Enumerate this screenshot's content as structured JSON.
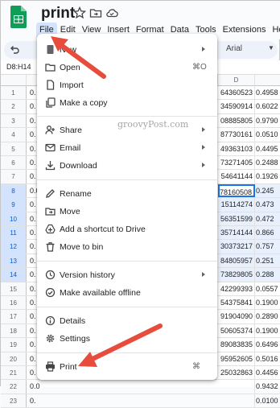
{
  "document": {
    "title": "print"
  },
  "menubar": {
    "items": [
      "File",
      "Edit",
      "View",
      "Insert",
      "Format",
      "Data",
      "Tools",
      "Extensions",
      "He"
    ],
    "active_index": 0
  },
  "toolbar": {
    "font": "Arial"
  },
  "namebox": "D8:H14",
  "grid": {
    "column_d_header": "D",
    "rows": [
      {
        "n": "1",
        "a": "0.",
        "d": "64360523",
        "e": "0.4958"
      },
      {
        "n": "2",
        "a": "0.",
        "d": "34590914",
        "e": "0.6022"
      },
      {
        "n": "3",
        "a": "0.",
        "d": "08885805",
        "e": "0.9790"
      },
      {
        "n": "4",
        "a": "0.",
        "d": "87730161",
        "e": "0.0510"
      },
      {
        "n": "5",
        "a": "0.",
        "d": "49363103",
        "e": "0.4495"
      },
      {
        "n": "6",
        "a": "0.",
        "d": "73271405",
        "e": "0.2488"
      },
      {
        "n": "7",
        "a": "0.",
        "d": "54641144",
        "e": "0.1926"
      },
      {
        "n": "8",
        "a": "0.0",
        "d": "78160508",
        "e": "0.245"
      },
      {
        "n": "9",
        "a": "0.",
        "d": "15114274",
        "e": "0.473"
      },
      {
        "n": "10",
        "a": "0.",
        "d": "56351599",
        "e": "0.472"
      },
      {
        "n": "11",
        "a": "0.",
        "d": "35714144",
        "e": "0.866"
      },
      {
        "n": "12",
        "a": "0.",
        "d": "30373217",
        "e": "0.757"
      },
      {
        "n": "13",
        "a": "0.",
        "d": "84805957",
        "e": "0.251"
      },
      {
        "n": "14",
        "a": "0.",
        "d": "73829805",
        "e": "0.288"
      },
      {
        "n": "15",
        "a": "0.",
        "d": "42299393",
        "e": "0.0557"
      },
      {
        "n": "16",
        "a": "0.",
        "d": "54375841",
        "e": "0.1900"
      },
      {
        "n": "17",
        "a": "0.",
        "d": "91904090",
        "e": "0.2890"
      },
      {
        "n": "18",
        "a": "0.",
        "d": "50605374",
        "e": "0.1900"
      },
      {
        "n": "19",
        "a": "0.",
        "d": "89083835",
        "e": "0.6496"
      },
      {
        "n": "20",
        "a": "0.",
        "d": "95952605",
        "e": "0.5016"
      },
      {
        "n": "21",
        "a": "0.",
        "d": "25032863",
        "e": "0.4456"
      },
      {
        "n": "22",
        "a": "0.0",
        "d": "",
        "e": "0.9432"
      },
      {
        "n": "23",
        "a": "0.",
        "d": "",
        "e": "0.0100"
      }
    ]
  },
  "file_menu": {
    "new": "New",
    "open": "Open",
    "open_shortcut": "⌘O",
    "import": "Import",
    "make_copy": "Make a copy",
    "share": "Share",
    "email": "Email",
    "download": "Download",
    "rename": "Rename",
    "move": "Move",
    "add_shortcut": "Add a shortcut to Drive",
    "move_to_bin": "Move to bin",
    "version_history": "Version history",
    "make_offline": "Make available offline",
    "details": "Details",
    "settings": "Settings",
    "print": "Print",
    "print_shortcut": "⌘"
  },
  "watermark": "groovyPost.com",
  "colors": {
    "arrow": "#e74c3c",
    "sheets_green": "#0f9d58",
    "selection": "#1a73e8"
  }
}
